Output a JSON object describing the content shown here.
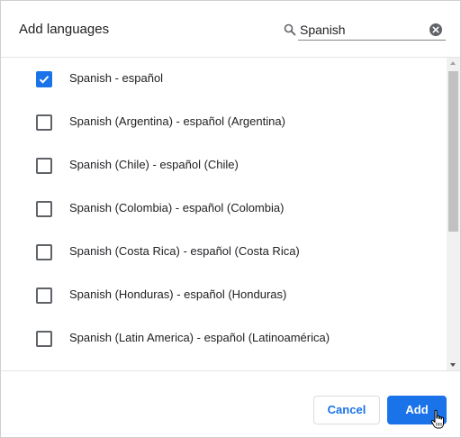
{
  "dialog": {
    "title": "Add languages"
  },
  "search": {
    "value": "Spanish",
    "icon": "search-icon",
    "clear_icon": "clear-icon"
  },
  "languages": [
    {
      "label": "Spanish - español",
      "checked": true
    },
    {
      "label": "Spanish (Argentina) - español (Argentina)",
      "checked": false
    },
    {
      "label": "Spanish (Chile) - español (Chile)",
      "checked": false
    },
    {
      "label": "Spanish (Colombia) - español (Colombia)",
      "checked": false
    },
    {
      "label": "Spanish (Costa Rica) - español (Costa Rica)",
      "checked": false
    },
    {
      "label": "Spanish (Honduras) - español (Honduras)",
      "checked": false
    },
    {
      "label": "Spanish (Latin America) - español (Latinoamérica)",
      "checked": false
    }
  ],
  "buttons": {
    "cancel_label": "Cancel",
    "add_label": "Add"
  },
  "colors": {
    "accent": "#1a73e8",
    "text": "#202124",
    "border": "#dadce0"
  }
}
